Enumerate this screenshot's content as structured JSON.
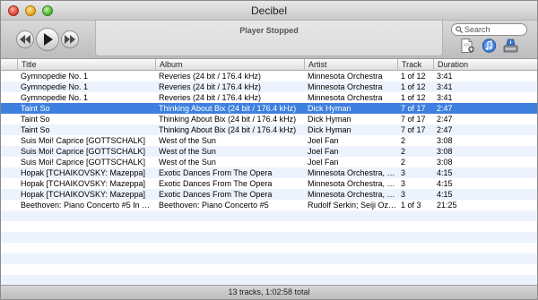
{
  "window": {
    "title": "Decibel"
  },
  "player": {
    "status": "Player Stopped"
  },
  "search": {
    "placeholder": "Search",
    "value": ""
  },
  "icons": {
    "previous": "previous-track-icon",
    "play": "play-icon",
    "next": "next-track-icon",
    "add": "add-file-icon",
    "itunes": "itunes-icon",
    "drive": "drive-icon"
  },
  "table": {
    "columns": [
      "Title",
      "Album",
      "Artist",
      "Track",
      "Duration"
    ],
    "selected_row": 3,
    "rows": [
      {
        "title": "Gymnopedie No. 1",
        "album": "Reveries (24 bit / 176.4 kHz)",
        "artist": "Minnesota Orchestra",
        "track": "1 of 12",
        "duration": "3:41"
      },
      {
        "title": "Gymnopedie No. 1",
        "album": "Reveries (24 bit / 176.4 kHz)",
        "artist": "Minnesota Orchestra",
        "track": "1 of 12",
        "duration": "3:41"
      },
      {
        "title": "Gymnopedie No. 1",
        "album": "Reveries (24 bit / 176.4 kHz)",
        "artist": "Minnesota Orchestra",
        "track": "1 of 12",
        "duration": "3:41"
      },
      {
        "title": "Taint So",
        "album": "Thinking About Bix (24 bit / 176.4 kHz)",
        "artist": "Dick Hyman",
        "track": "7 of 17",
        "duration": "2:47"
      },
      {
        "title": "Taint So",
        "album": "Thinking About Bix (24 bit / 176.4 kHz)",
        "artist": "Dick Hyman",
        "track": "7 of 17",
        "duration": "2:47"
      },
      {
        "title": "Taint So",
        "album": "Thinking About Bix (24 bit / 176.4 kHz)",
        "artist": "Dick Hyman",
        "track": "7 of 17",
        "duration": "2:47"
      },
      {
        "title": "Suis Moi! Caprice [GOTTSCHALK]",
        "album": "West of the Sun",
        "artist": "Joel Fan",
        "track": "2",
        "duration": "3:08"
      },
      {
        "title": "Suis Moi! Caprice [GOTTSCHALK]",
        "album": "West of the Sun",
        "artist": "Joel Fan",
        "track": "2",
        "duration": "3:08"
      },
      {
        "title": "Suis Moi! Caprice [GOTTSCHALK]",
        "album": "West of the Sun",
        "artist": "Joel Fan",
        "track": "2",
        "duration": "3:08"
      },
      {
        "title": "Hopak [TCHAIKOVSKY: Mazeppa]",
        "album": "Exotic Dances From The Opera",
        "artist": "Minnesota Orchestra, E...",
        "track": "3",
        "duration": "4:15"
      },
      {
        "title": "Hopak [TCHAIKOVSKY: Mazeppa]",
        "album": "Exotic Dances From The Opera",
        "artist": "Minnesota Orchestra, E...",
        "track": "3",
        "duration": "4:15"
      },
      {
        "title": "Hopak [TCHAIKOVSKY: Mazeppa]",
        "album": "Exotic Dances From The Opera",
        "artist": "Minnesota Orchestra, E...",
        "track": "3",
        "duration": "4:15"
      },
      {
        "title": "Beethoven: Piano Concerto #5 In E Fl...",
        "album": "Beethoven: Piano Concerto #5",
        "artist": "Rudolf Serkin; Seiji Oza...",
        "track": "1 of 3",
        "duration": "21:25"
      }
    ]
  },
  "statusbar": {
    "text": "13 tracks, 1:02:58 total"
  },
  "colors": {
    "selection": "#3d80df",
    "stripe": "#edf3fe"
  }
}
